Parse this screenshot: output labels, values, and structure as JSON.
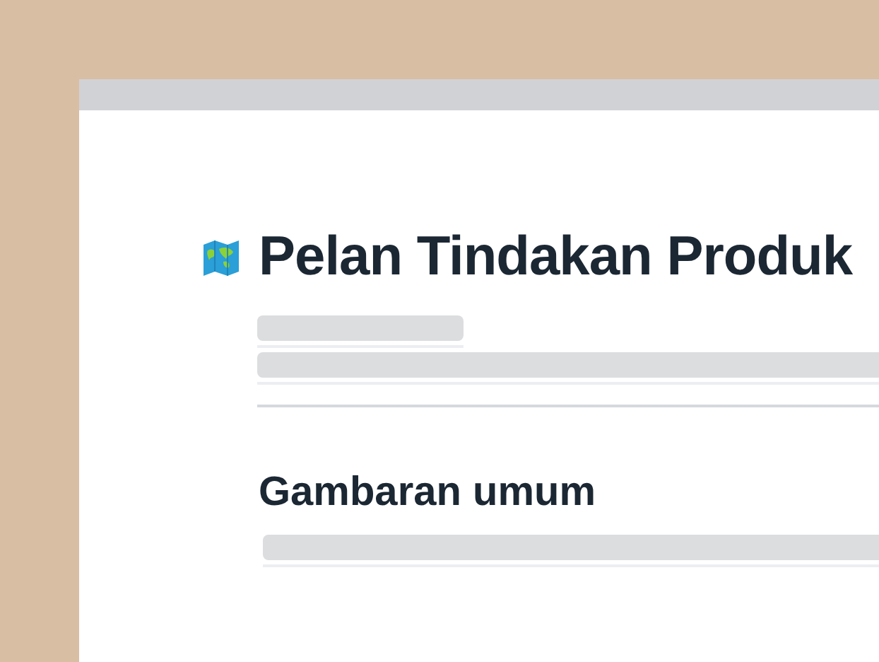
{
  "document": {
    "title": "Pelan Tindakan Produk",
    "sections": [
      {
        "heading": "Gambaran umum"
      }
    ]
  }
}
